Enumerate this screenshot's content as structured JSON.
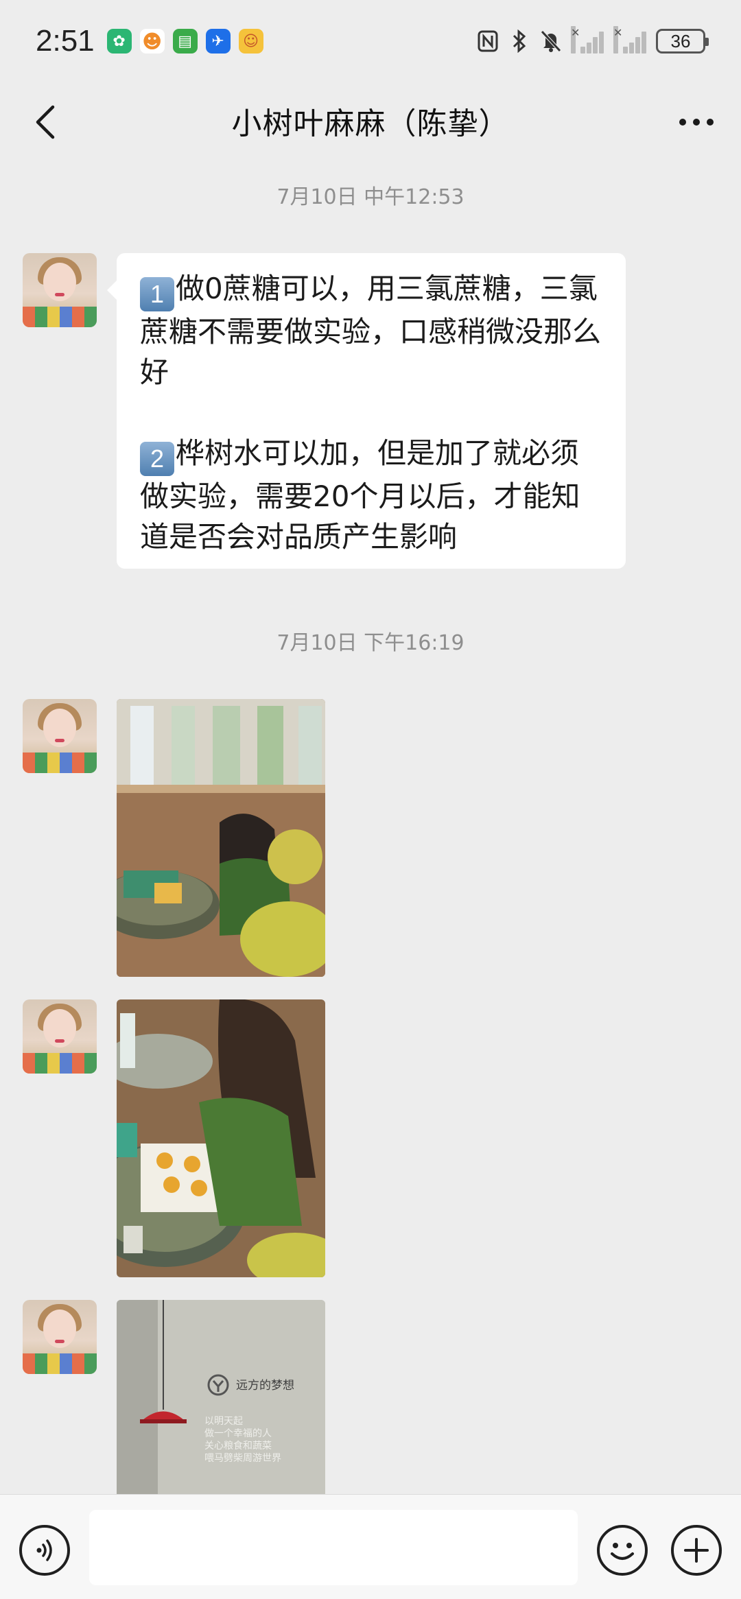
{
  "status_bar": {
    "time": "2:51",
    "battery": "36",
    "app_icons": [
      "green-leaf-app-icon",
      "orange-mascot-app-icon",
      "green-basket-app-icon",
      "blue-plane-app-icon",
      "yellow-cat-app-icon"
    ]
  },
  "header": {
    "title": "小树叶麻麻（陈挚）"
  },
  "chat": {
    "timestamps": [
      "7月10日 中午12:53",
      "7月10日 下午16:19"
    ],
    "message1": {
      "badge1": "1",
      "para1": "做0蔗糖可以，用三氯蔗糖，三氯蔗糖不需要做实验，口感稍微没那么好",
      "badge2": "2",
      "para2": "桦树水可以加，但是加了就必须做实验，需要20个月以后，才能知道是否会对品质产生影响"
    },
    "photo3_sign": {
      "brand": "远方的梦想",
      "line1": "以明天起",
      "line2": "做一个幸福的人",
      "line3": "关心粮食和蔬菜",
      "line4": "喂马劈柴周游世界"
    }
  },
  "colors": {
    "background": "#ededed",
    "bubble": "#ffffff",
    "timestamp": "#8e8e8e"
  }
}
